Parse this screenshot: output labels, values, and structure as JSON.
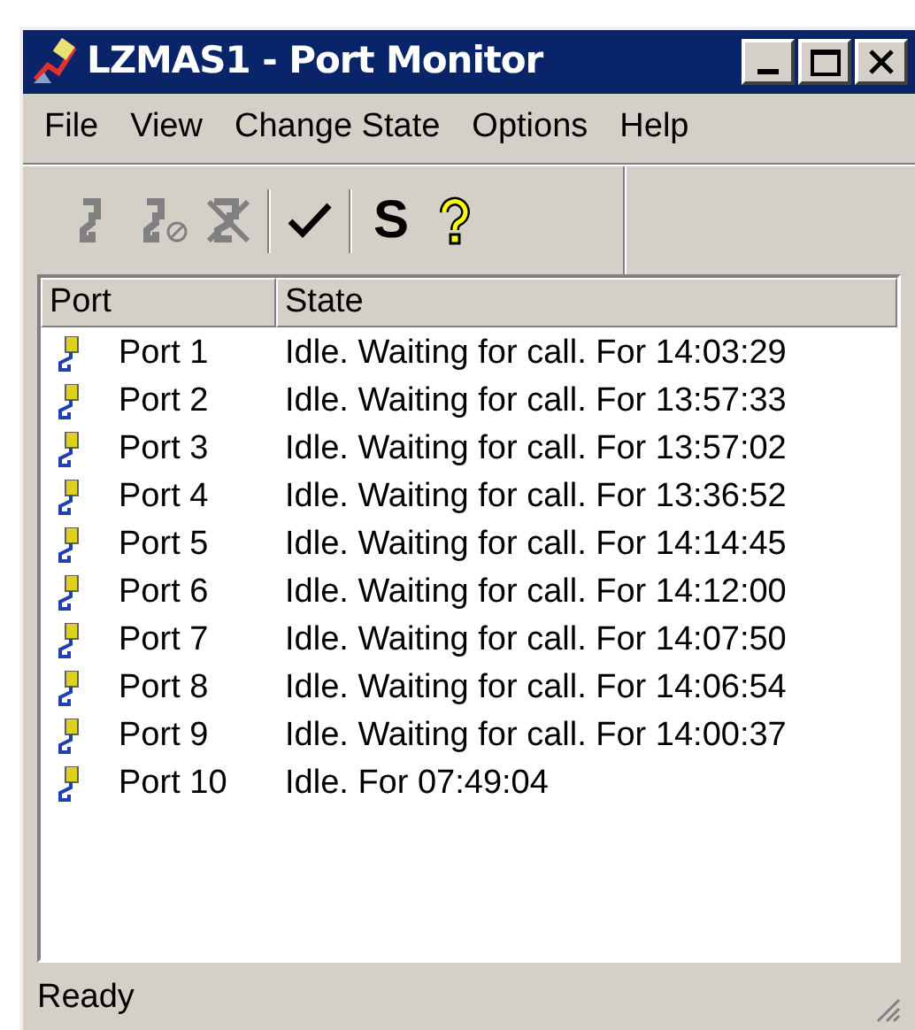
{
  "window": {
    "title": "LZMAS1 - Port Monitor"
  },
  "menu": [
    "File",
    "View",
    "Change State",
    "Options",
    "Help"
  ],
  "toolbar": [
    {
      "kind": "port",
      "disabled": true
    },
    {
      "kind": "port-blocked",
      "disabled": true
    },
    {
      "kind": "port-cross",
      "disabled": true
    },
    {
      "kind": "separator"
    },
    {
      "kind": "check",
      "disabled": false
    },
    {
      "kind": "separator"
    },
    {
      "kind": "text",
      "label": "S",
      "disabled": false
    },
    {
      "kind": "help",
      "disabled": false
    }
  ],
  "table": {
    "columns": [
      "Port",
      "State"
    ],
    "rows": [
      {
        "port": "Port 1",
        "state": "Idle. Waiting for call. For 14:03:29"
      },
      {
        "port": "Port 2",
        "state": "Idle. Waiting for call. For 13:57:33"
      },
      {
        "port": "Port 3",
        "state": "Idle. Waiting for call. For 13:57:02"
      },
      {
        "port": "Port 4",
        "state": "Idle. Waiting for call. For 13:36:52"
      },
      {
        "port": "Port 5",
        "state": "Idle. Waiting for call. For 14:14:45"
      },
      {
        "port": "Port 6",
        "state": "Idle. Waiting for call. For 14:12:00"
      },
      {
        "port": "Port 7",
        "state": "Idle. Waiting for call. For 14:07:50"
      },
      {
        "port": "Port 8",
        "state": "Idle. Waiting for call. For 14:06:54"
      },
      {
        "port": "Port 9",
        "state": "Idle. Waiting for call. For 14:00:37"
      },
      {
        "port": "Port 10",
        "state": "Idle. For 07:49:04"
      }
    ]
  },
  "status_bar": "Ready"
}
